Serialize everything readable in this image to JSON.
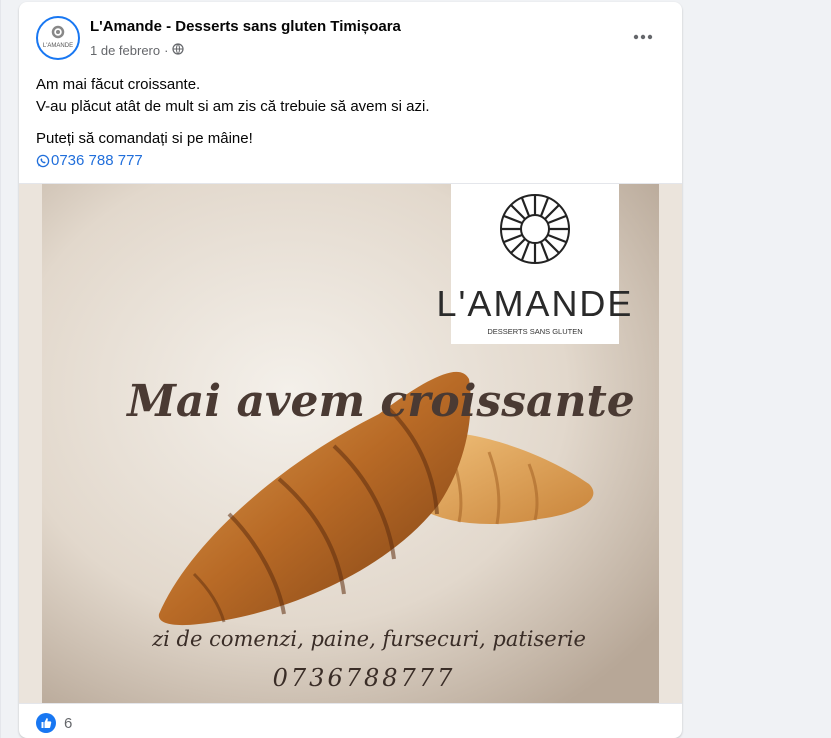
{
  "post": {
    "page_name": "L'Amande - Desserts sans gluten Timișoara",
    "date": "1 de febrero",
    "separator": "·",
    "privacy_icon": "globe-icon",
    "more_icon": "more-horizontal-icon",
    "avatar_text": "L'AMANDE",
    "lines": [
      "Am mai făcut croissante.",
      "V-au plăcut atât de mult si am zis că trebuie să avem si azi.",
      "Puteți să comandați si pe mâine!"
    ],
    "phone": "0736 788 777",
    "phone_icon": "whatsapp-icon"
  },
  "image": {
    "brand": "L'AMANDE",
    "brand_sub": "DESSERTS SANS GLUTEN",
    "headline": "Mai avem croissante",
    "tagline": "zi de comenzi, paine, fursecuri, patiserie",
    "phone": "0736788777"
  },
  "reactions": {
    "icon": "like-icon",
    "count": "6"
  },
  "colors": {
    "accent": "#1877f2",
    "link": "#216fdb",
    "script_text": "#4a3a33"
  }
}
